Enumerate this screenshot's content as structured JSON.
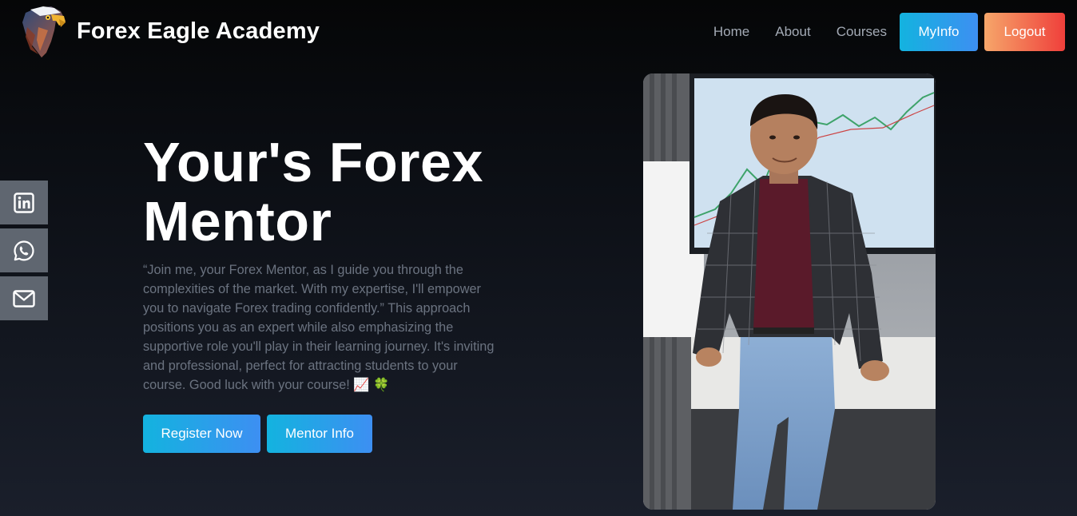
{
  "navbar": {
    "brand_name": "Forex Eagle Academy",
    "logo_icon": "eagle-logo-icon",
    "links": [
      "Home",
      "About",
      "Courses"
    ],
    "myinfo_label": "MyInfo",
    "logout_label": "Logout"
  },
  "social": [
    {
      "icon": "linkedin-icon"
    },
    {
      "icon": "whatsapp-icon"
    },
    {
      "icon": "mail-icon"
    }
  ],
  "hero": {
    "title_line1": "Your's Forex",
    "title_line2": "Mentor",
    "description": "“Join me, your Forex Mentor, as I guide you through the complexities of the market. With my expertise, I'll empower you to navigate Forex trading confidently.” This approach positions you as an expert while also emphasizing the supportive role you'll play in their learning journey. It's inviting and professional, perfect for attracting students to your course. Good luck with your course! 📈 🍀",
    "register_label": "Register Now",
    "mentor_label": "Mentor Info"
  },
  "colors": {
    "primary_gradient_start": "#13b3df",
    "primary_gradient_end": "#3d8ff2",
    "logout_gradient_start": "#f6a66a",
    "logout_gradient_end": "#ef3f3b",
    "social_bg": "#5f6670",
    "muted_text": "#6b7380"
  }
}
